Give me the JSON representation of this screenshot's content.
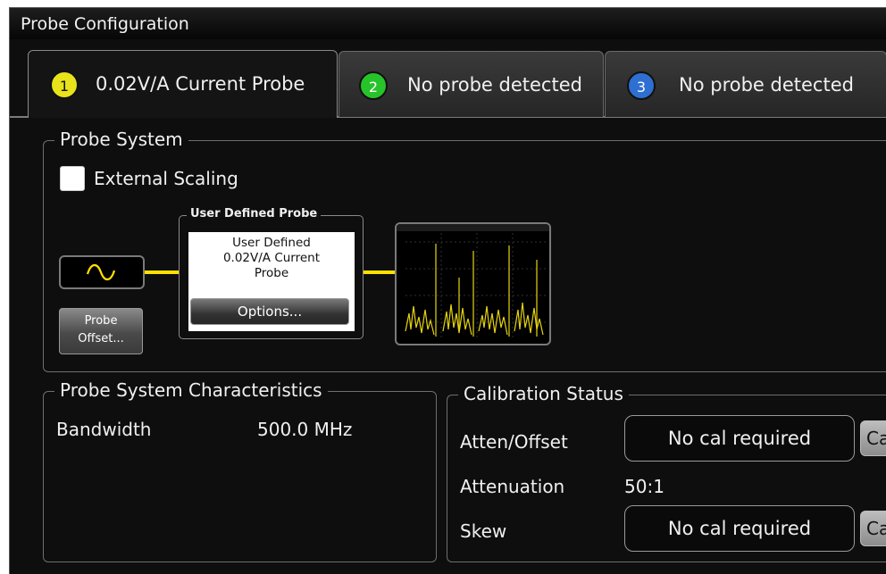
{
  "window": {
    "title": "Probe Configuration"
  },
  "tabs": [
    {
      "number": "1",
      "label": "0.02V/A Current Probe",
      "badge_color": "#e8e31a",
      "active": true
    },
    {
      "number": "2",
      "label": "No probe detected",
      "badge_color": "#27c32a",
      "active": false
    },
    {
      "number": "3",
      "label": "No probe detected",
      "badge_color": "#2e6fd1",
      "active": false
    }
  ],
  "probe_system": {
    "legend": "Probe System",
    "external_scaling_label": "External Scaling",
    "external_scaling_checked": false,
    "probe_offset_button": [
      "Probe",
      "Offset..."
    ],
    "user_defined_probe": {
      "legend": "User Defined  Probe",
      "lines": [
        "User Defined",
        "0.02V/A Current",
        "Probe"
      ],
      "options_button": "Options..."
    },
    "wire_color": "#ffe100",
    "signal_icon": "sine-wave-icon",
    "scope_icon": "oscilloscope-thumbnail"
  },
  "characteristics": {
    "legend": "Probe System Characteristics",
    "bandwidth_label": "Bandwidth",
    "bandwidth_value": "500.0 MHz"
  },
  "calibration": {
    "legend": "Calibration Status",
    "atten_offset_label": "Atten/Offset",
    "atten_offset_status": "No cal required",
    "attenuation_label": "Attenuation",
    "attenuation_value": "50:1",
    "skew_label": "Skew",
    "skew_status": "No cal required",
    "cal_button_label": "Ca"
  }
}
